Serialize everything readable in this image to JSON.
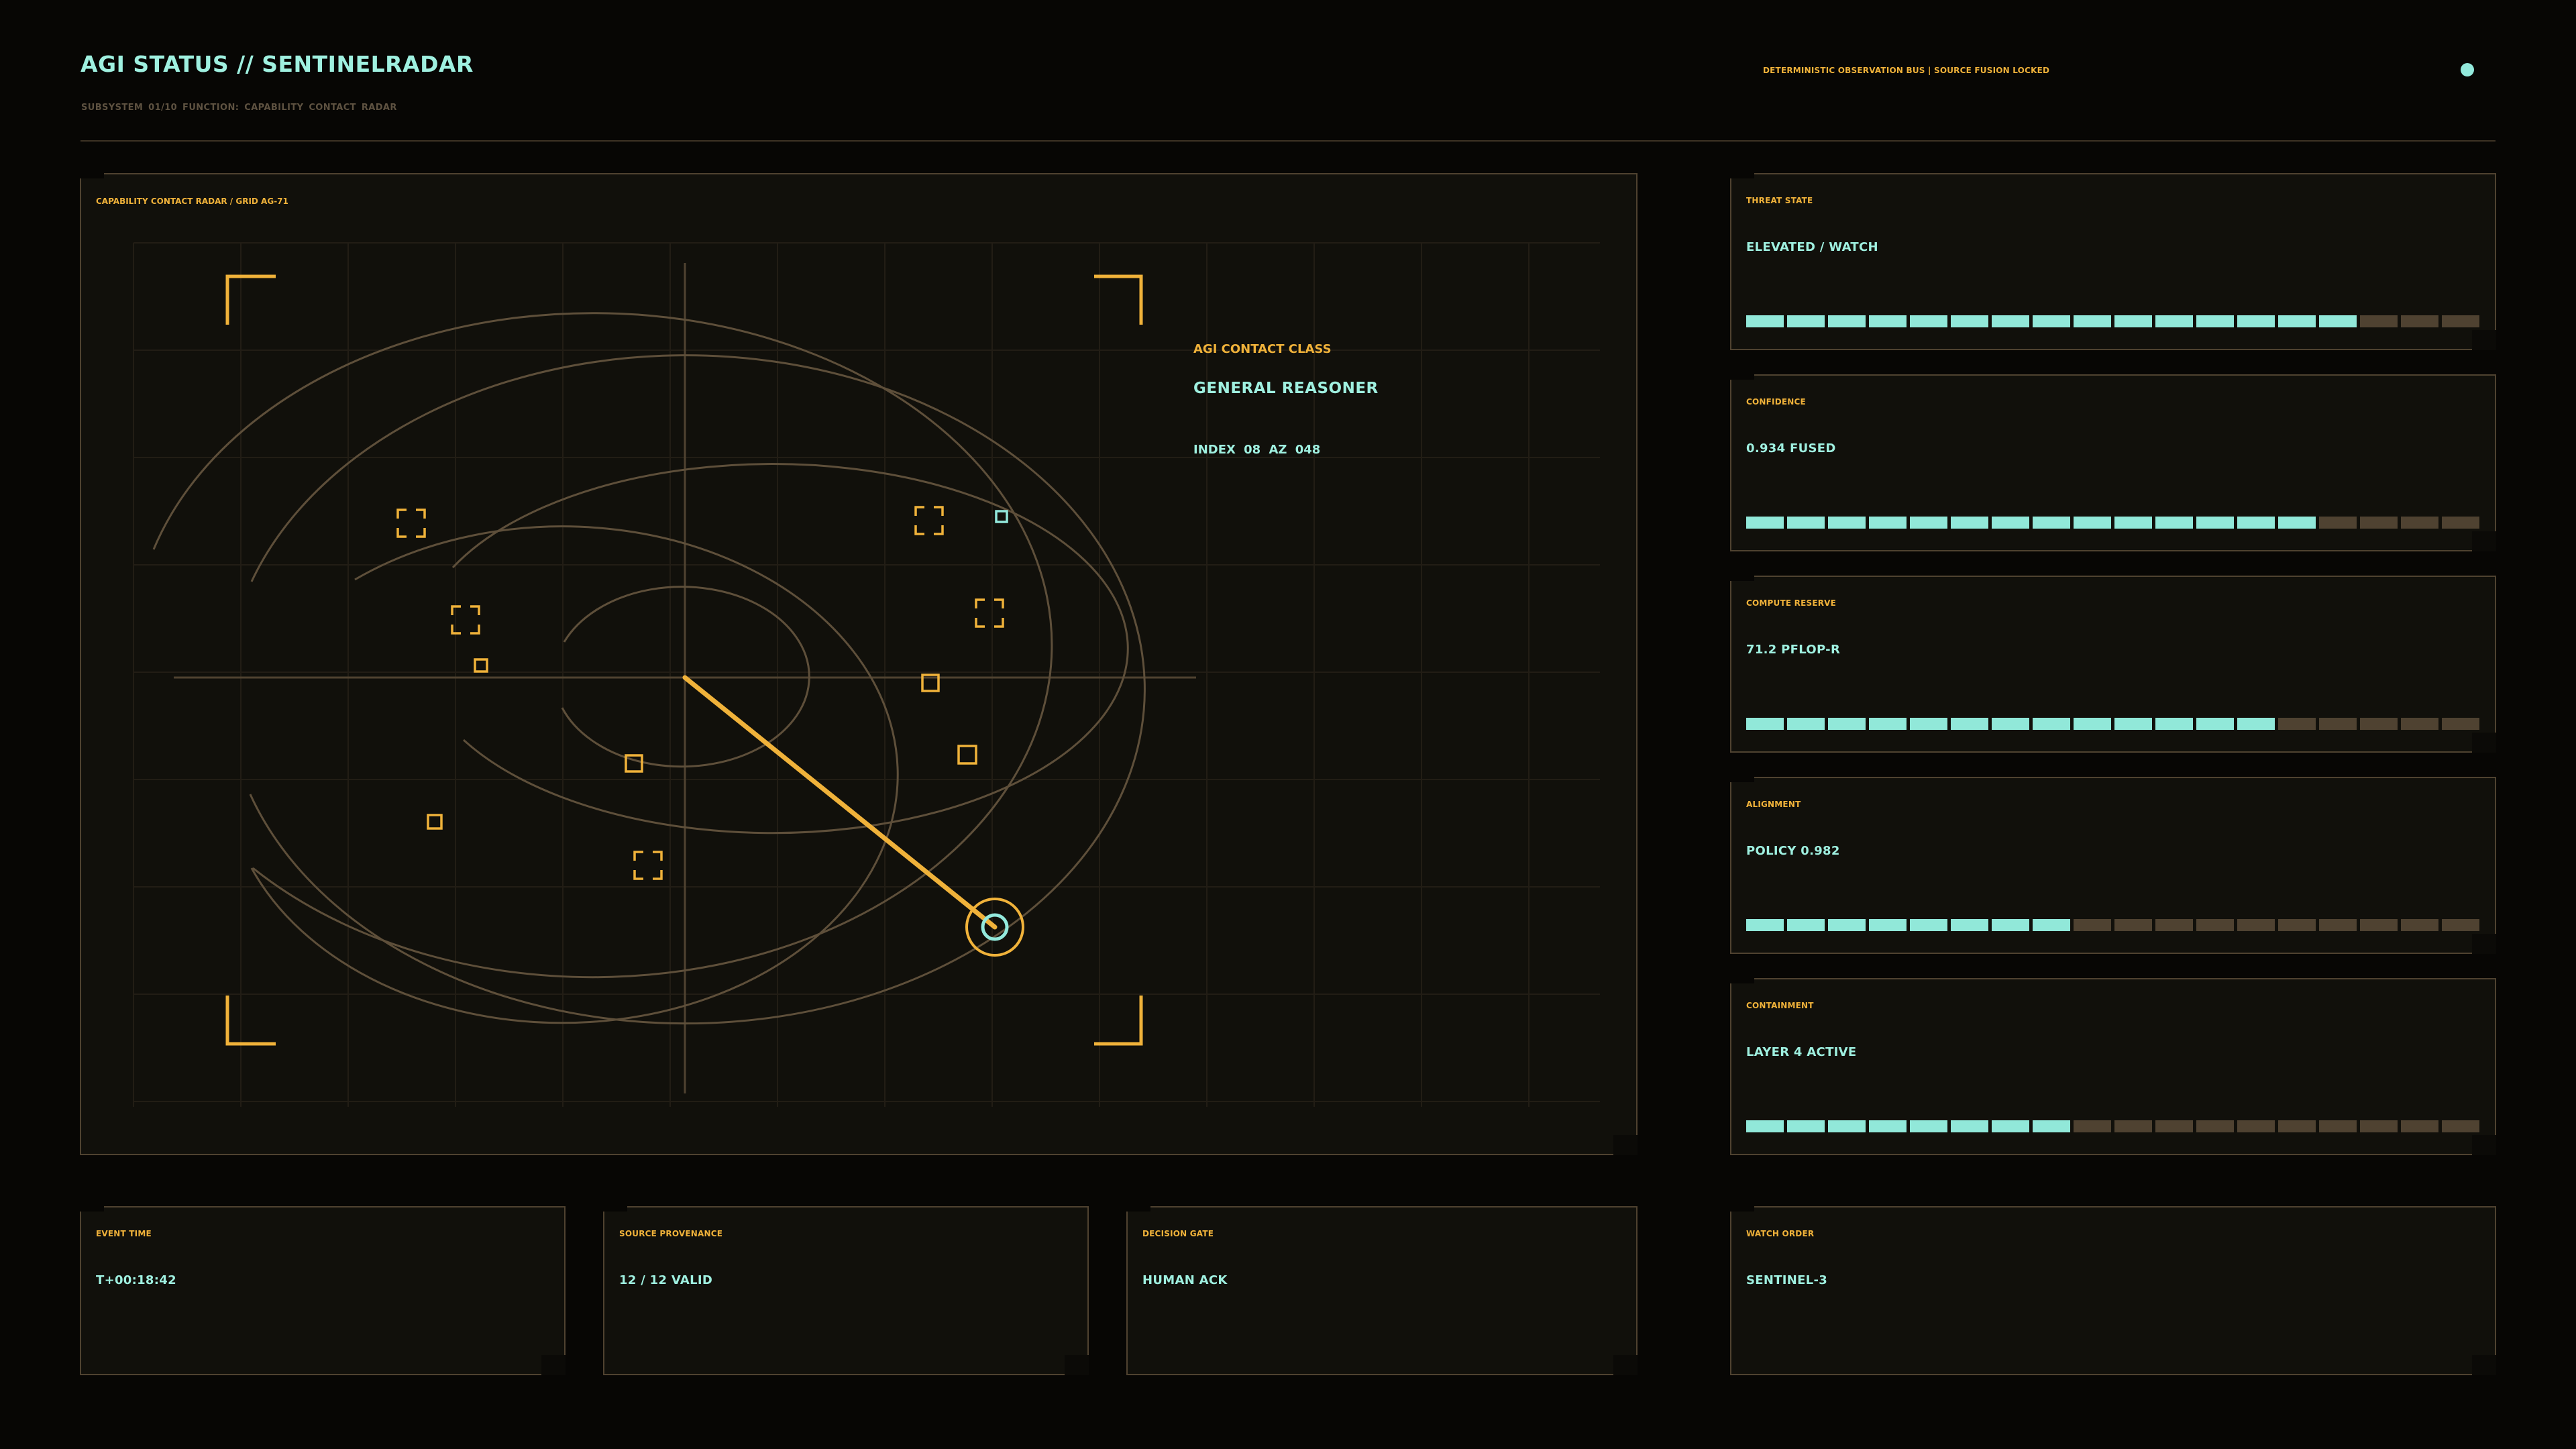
{
  "header": {
    "title": "AGI STATUS // SENTINELRADAR",
    "subtitle": "SUBSYSTEM 01/10   FUNCTION: CAPABILITY CONTACT RADAR",
    "status": "DETERMINISTIC OBSERVATION BUS | SOURCE FUSION LOCKED",
    "status_dot_color": "#93e9dc"
  },
  "radar": {
    "label": "CAPABILITY CONTACT RADAR / GRID AG-71",
    "contact_class_label": "AGI CONTACT CLASS",
    "contact_class_value": "GENERAL REASONER",
    "contact_index": "INDEX 08  AZ 048",
    "accent_color": "#f0b23a",
    "target_color": "#93e9dc"
  },
  "metrics": [
    {
      "label": "THREAT STATE",
      "value": "ELEVATED / WATCH",
      "level": 15,
      "total": 18
    },
    {
      "label": "CONFIDENCE",
      "value": "0.934 FUSED",
      "level": 14,
      "total": 18
    },
    {
      "label": "COMPUTE RESERVE",
      "value": "71.2 PFLOP-R",
      "level": 13,
      "total": 18
    },
    {
      "label": "ALIGNMENT",
      "value": "POLICY 0.982",
      "level": 8,
      "total": 18
    },
    {
      "label": "CONTAINMENT",
      "value": "LAYER 4 ACTIVE",
      "level": 8,
      "total": 18
    }
  ],
  "footer": [
    {
      "label": "EVENT TIME",
      "value": "T+00:18:42"
    },
    {
      "label": "SOURCE PROVENANCE",
      "value": "12 / 12 VALID"
    },
    {
      "label": "DECISION GATE",
      "value": "HUMAN ACK"
    },
    {
      "label": "WATCH ORDER",
      "value": "SENTINEL-3"
    }
  ],
  "colors": {
    "background": "#070604",
    "panel": "#11100b",
    "panel_border": "#4f4230",
    "bar_on": "#91e8d9",
    "bar_off": "#4f4231"
  }
}
